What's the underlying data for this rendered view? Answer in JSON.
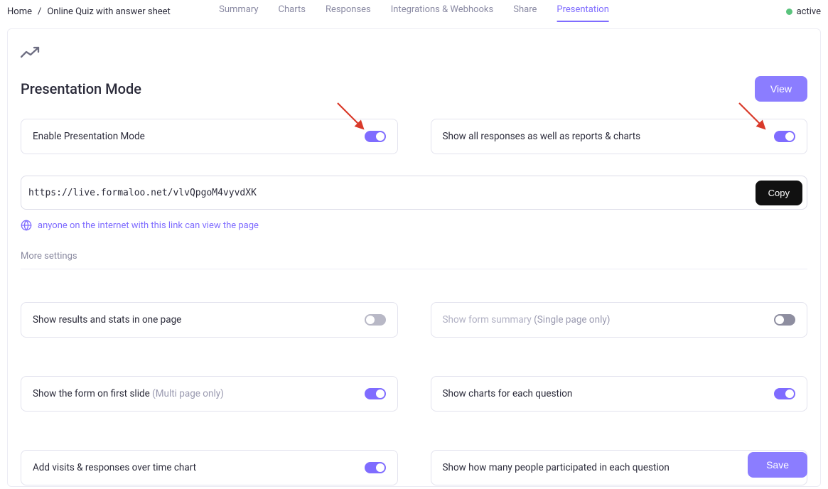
{
  "breadcrumb": {
    "home": "Home",
    "current": "Online Quiz with answer sheet"
  },
  "tabs": {
    "summary": "Summary",
    "charts": "Charts",
    "responses": "Responses",
    "integrations": "Integrations & Webhooks",
    "share": "Share",
    "presentation": "Presentation"
  },
  "status": {
    "label": "active"
  },
  "page": {
    "title": "Presentation Mode",
    "view_btn": "View",
    "save_btn": "Save",
    "more_settings": "More settings"
  },
  "url": {
    "value": "https://live.formaloo.net/vlvQpgoM4vyvdXK",
    "copy": "Copy",
    "share_note": "anyone on the internet with this link can view the page"
  },
  "toggles": {
    "enable": {
      "label": "Enable Presentation Mode",
      "on": true
    },
    "show_all": {
      "label": "Show all responses as well as reports & charts",
      "on": true
    },
    "one_page": {
      "label": "Show results and stats in one page",
      "on": false
    },
    "summary": {
      "label": "Show form summary ",
      "suffix": "(Single page only)",
      "on": false,
      "disabled": true
    },
    "first_slide": {
      "label": "Show the form on first slide ",
      "suffix": "(Multi page only)",
      "on": true
    },
    "charts_each": {
      "label": "Show charts for each question",
      "on": true
    },
    "visits": {
      "label": "Add visits & responses over time chart",
      "on": true
    },
    "participated": {
      "label": "Show how many people participated in each question",
      "on": true
    }
  }
}
